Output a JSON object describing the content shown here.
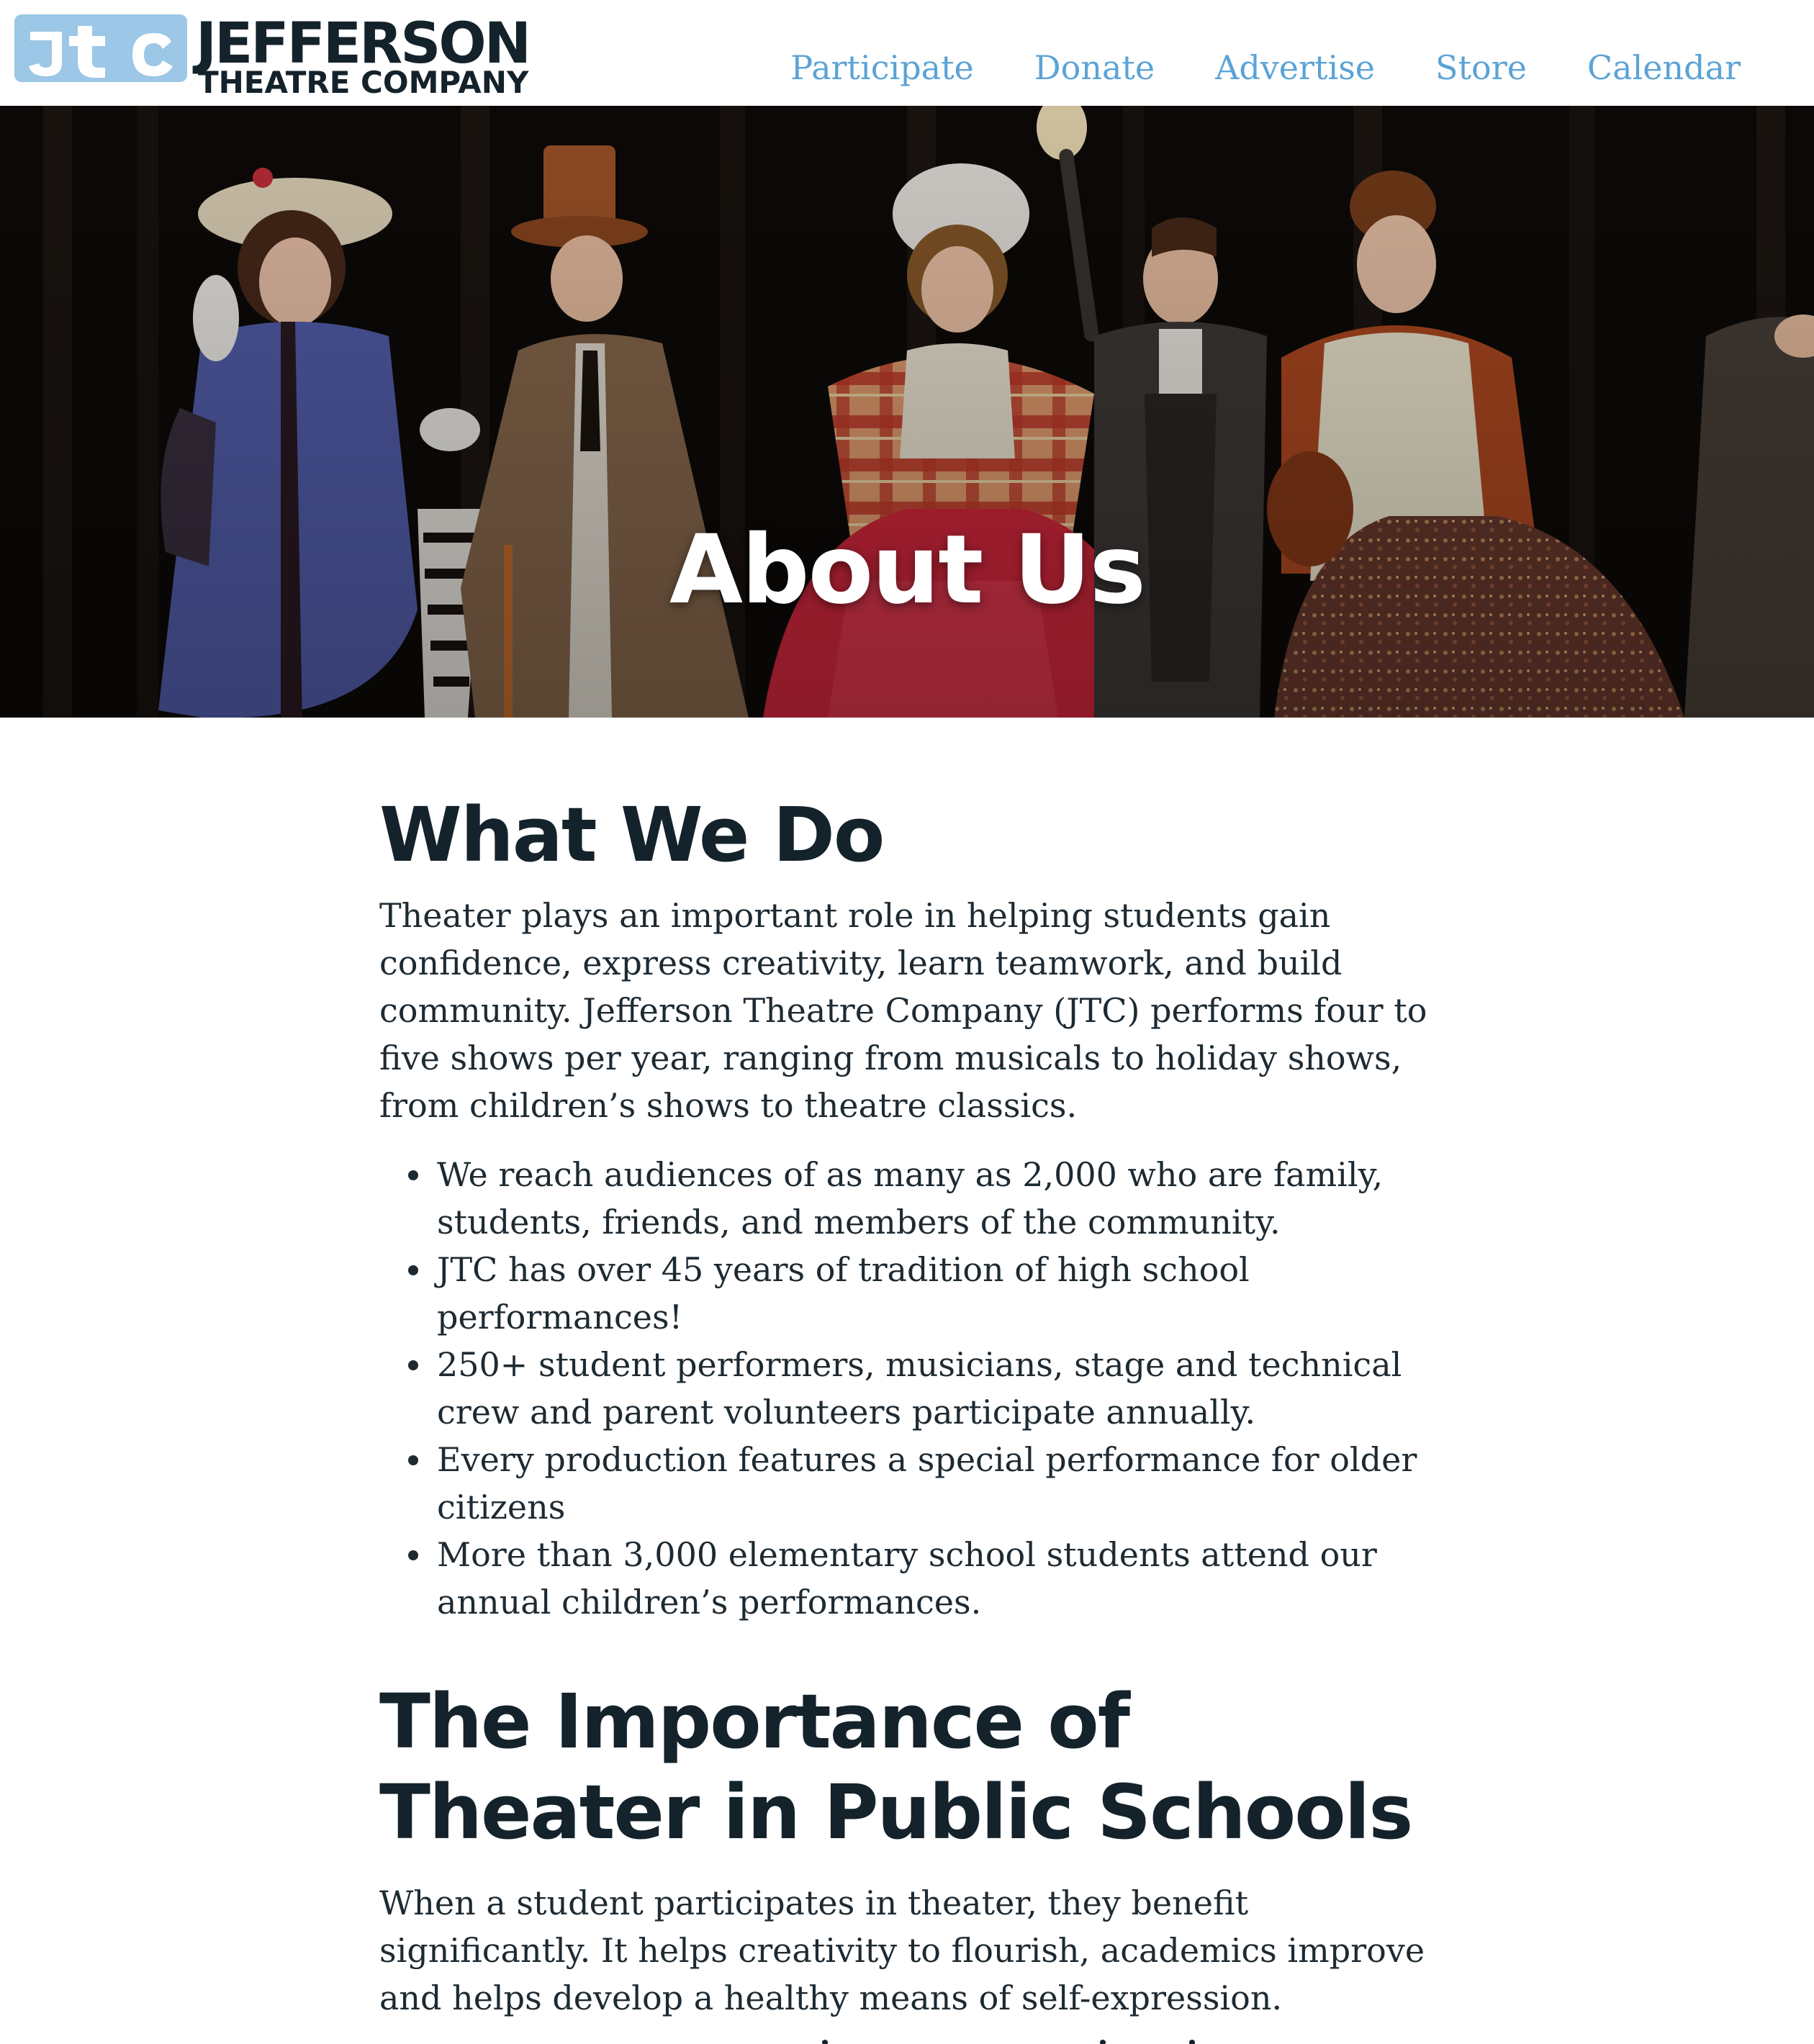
{
  "header": {
    "logo_line1": "JEFFERSON",
    "logo_line2": "THEATRE COMPANY",
    "logo_mark_color": "#9cc7e6",
    "nav": [
      {
        "label": "Participate"
      },
      {
        "label": "Donate"
      },
      {
        "label": "Advertise"
      },
      {
        "label": "Store"
      },
      {
        "label": "Calendar"
      }
    ],
    "nav_color": "#5ca3d6"
  },
  "hero": {
    "title": "About Us"
  },
  "what_we_do": {
    "heading": "What We Do",
    "intro": "Theater plays an important role in helping students gain confidence, express creativity, learn teamwork, and build community.  Jefferson Theatre Company (JTC) performs four to five shows per year, ranging from musicals to holiday shows, from children’s shows to theatre classics.",
    "bullets": [
      "We reach audiences of as many as 2,000 who are family, students, friends, and members of the community.",
      "JTC has over 45 years of tradition of high school performances!",
      "250+ student performers, musicians, stage and technical crew and parent volunteers participate annually.",
      "Every production features a special performance for older citizens",
      "More than 3,000 elementary school students attend our annual children’s performances."
    ]
  },
  "importance": {
    "heading_line1": "The Importance of",
    "heading_line2": "Theater in Public Schools",
    "paragraph": "When a student participates in theater, they benefit significantly. It helps creativity to flourish, academics improve and helps develop a healthy means of self-expression."
  },
  "colors": {
    "heading": "#14222b",
    "body_text": "#1e2a32",
    "hero_text": "#ffffff"
  }
}
